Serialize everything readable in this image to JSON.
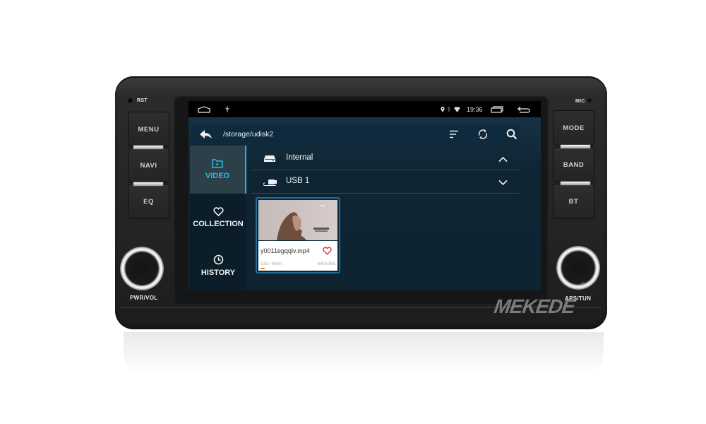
{
  "device": {
    "brand_watermark": "MEKEDE",
    "registered_mark": "®",
    "left_panel": {
      "reset_label": "RST",
      "buttons": [
        {
          "label": "MENU"
        },
        {
          "label": "NAVI"
        },
        {
          "label": "EQ"
        }
      ],
      "knob_label": "PWR/VOL"
    },
    "right_panel": {
      "mic_label": "MIC",
      "buttons": [
        {
          "label": "MODE"
        },
        {
          "label": "BAND"
        },
        {
          "label": "BT"
        }
      ],
      "knob_label": "APS/TUN"
    }
  },
  "status_bar": {
    "left_icons": [
      "home-icon",
      "usb-icon"
    ],
    "right_icons": [
      "location-icon",
      "bluetooth-icon",
      "wifi-icon"
    ],
    "time": "19:36",
    "nav_icons": [
      "recent-apps-icon",
      "back-icon"
    ]
  },
  "app": {
    "toolbar": {
      "path": "/storage/udisk2",
      "icons": [
        "back-arrow-icon",
        "sort-icon",
        "refresh-icon",
        "search-icon"
      ]
    },
    "sidebar": {
      "items": [
        {
          "label": "VIDEO",
          "icon": "video-folder-icon",
          "active": true
        },
        {
          "label": "COLLECTION",
          "icon": "heart-icon",
          "active": false
        },
        {
          "label": "HISTORY",
          "icon": "clock-icon",
          "active": false
        }
      ]
    },
    "drives": [
      {
        "label": "Internal",
        "icon": "drive-icon",
        "expanded": true
      },
      {
        "label": "USB 1",
        "icon": "usb-drive-icon",
        "expanded": false
      }
    ],
    "videos": [
      {
        "filename": "y0011egqqlv.mp4",
        "progress_text": "13s / 4min",
        "progress_fraction": 0.054,
        "resolution": "640x368",
        "favorite": false
      }
    ]
  },
  "colors": {
    "accent": "#29b8e0",
    "screen_bg": "#0f2533",
    "favorite": "#e0312f",
    "progress": "#f08a1c"
  }
}
